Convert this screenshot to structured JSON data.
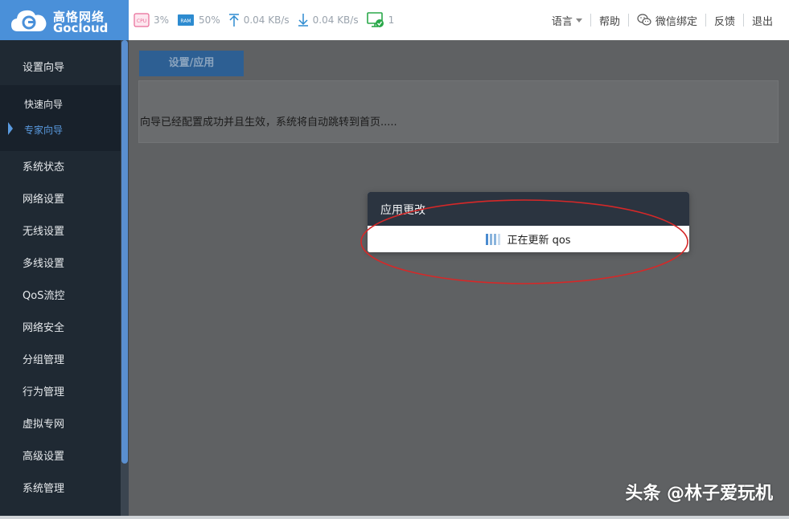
{
  "brand": {
    "cn": "高恪网络",
    "en": "Gocloud"
  },
  "stats": {
    "cpu_label": "CPU",
    "cpu": "3%",
    "ram_label": "RAM",
    "ram": "50%",
    "upload": "0.04 KB/s",
    "download": "0.04 KB/s",
    "devices": "1"
  },
  "topnav": {
    "language": "语言",
    "help": "帮助",
    "wechat": "微信绑定",
    "feedback": "反馈",
    "logout": "退出"
  },
  "sidebar": {
    "items": [
      {
        "label": "设置向导"
      },
      {
        "label": "系统状态"
      },
      {
        "label": "网络设置"
      },
      {
        "label": "无线设置"
      },
      {
        "label": "多线设置"
      },
      {
        "label": "QoS流控"
      },
      {
        "label": "网络安全"
      },
      {
        "label": "分组管理"
      },
      {
        "label": "行为管理"
      },
      {
        "label": "虚拟专网"
      },
      {
        "label": "高级设置"
      },
      {
        "label": "系统管理"
      }
    ],
    "sub_items": [
      {
        "label": "快速向导"
      },
      {
        "label": "专家向导"
      }
    ]
  },
  "main": {
    "tab": "设置/应用",
    "message": "向导已经配置成功并且生效，系统将自动跳转到首页....."
  },
  "modal": {
    "title": "应用更改",
    "status": "正在更新 qos"
  },
  "watermark": "头条 @林子爱玩机",
  "colors": {
    "accent": "#4a90d9",
    "sidebar": "#1f2933",
    "annotation": "#d62828"
  }
}
